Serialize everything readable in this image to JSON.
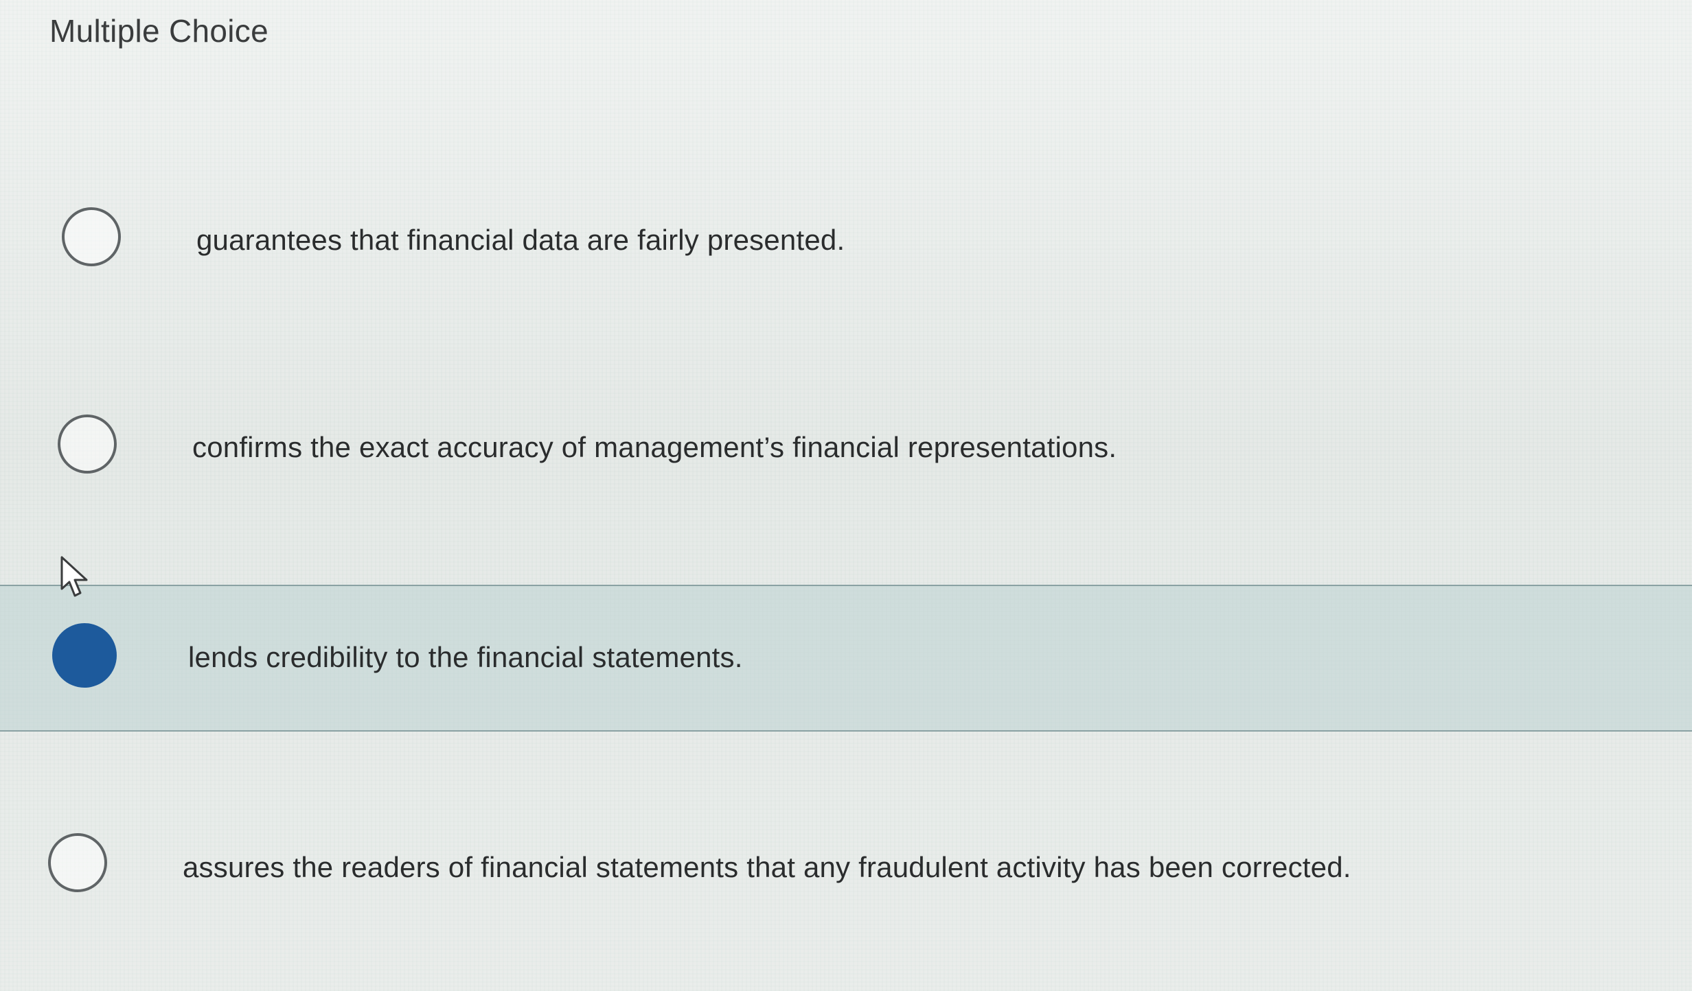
{
  "question": {
    "title": "Multiple Choice"
  },
  "options": [
    {
      "label": "guarantees that financial data are fairly presented.",
      "selected": false
    },
    {
      "label": "confirms the exact accuracy of management’s financial representations.",
      "selected": false
    },
    {
      "label": "lends credibility to the financial statements.",
      "selected": true
    },
    {
      "label": "assures the readers of financial statements that any fraudulent activity has been corrected.",
      "selected": false
    }
  ],
  "colors": {
    "selected_radio": "#1d5a9c",
    "selected_row": "#c4d7d6"
  },
  "icons": {
    "cursor": "mouse-pointer-icon"
  }
}
